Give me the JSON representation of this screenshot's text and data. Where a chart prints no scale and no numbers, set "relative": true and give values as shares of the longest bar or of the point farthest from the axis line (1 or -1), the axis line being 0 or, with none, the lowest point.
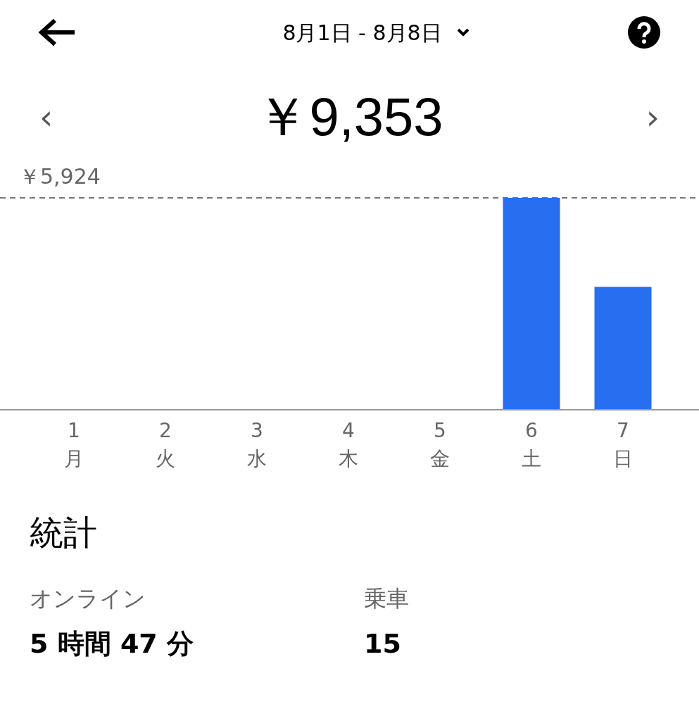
{
  "header": {
    "title": "8月1日 - 8月8日"
  },
  "total": {
    "amount": "￥9,353",
    "prev": "‹",
    "next": "›"
  },
  "chart": {
    "weekdays": [
      "月",
      "火",
      "水",
      "木",
      "金",
      "土",
      "日"
    ],
    "max_label": "￥5,924",
    "chart_data": {
      "type": "bar",
      "categories": [
        "1",
        "2",
        "3",
        "4",
        "5",
        "6",
        "7"
      ],
      "values": [
        0,
        0,
        0,
        0,
        0,
        1,
        0.58
      ],
      "relative": true
    }
  },
  "stats": {
    "title": "統計",
    "items": [
      {
        "label": "オンライン",
        "value": "5 時間 47 分"
      },
      {
        "label": "乗車",
        "value": "15"
      }
    ]
  }
}
